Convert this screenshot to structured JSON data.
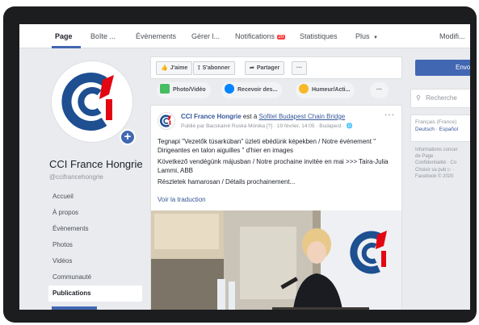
{
  "tabs": [
    {
      "label": "Page",
      "active": true
    },
    {
      "label": "Boîte ..."
    },
    {
      "label": "Évènements"
    },
    {
      "label": "Gérer l..."
    },
    {
      "label": "Notifications",
      "badge": "20"
    },
    {
      "label": "Statistiques"
    },
    {
      "label": "Plus"
    },
    {
      "label": "Modifi..."
    }
  ],
  "page": {
    "name": "CCI France Hongrie",
    "handle": "@ccifrancehongrie"
  },
  "side_nav": [
    "Accueil",
    "À propos",
    "Évènements",
    "Photos",
    "Vidéos",
    "Communauté",
    "Publications"
  ],
  "side_nav_active": "Publications",
  "actions": {
    "like": "J'aime",
    "follow": "S'abonner",
    "share": "Partager",
    "more": "···"
  },
  "composer": {
    "photo": "Photo/Vidéo",
    "messages": "Recevoir des...",
    "mood": "Humeur/Acti...",
    "more": "···"
  },
  "post": {
    "author": "CCI France Hongrie",
    "at_text": "est à",
    "location": "Sofitel Budapest Chain Bridge",
    "meta": "Publié par Bacskainé Ruska Mónika [?] · 19 février, 14:05 · Budapest · ",
    "text1": "Tegnapi \"Vezetők túsarkúban\" üzleti ebédünk képekben / Notre événement \" Dirigeantes en talon aiguilles \" d'hier en images",
    "text2": "Következő vendégünk májusban / Notre prochaine invitée en mai >>> Taira-Julia Lammi, ABB",
    "text3": "Részletek hamarosan / Détails prochainement...",
    "see_translation": "Voir la traduction",
    "dots": "···"
  },
  "right": {
    "send_label": "Envo",
    "search_placeholder": "Recherche",
    "lang_line1": "Français (France)",
    "lang_line2": "Deutsch · Español",
    "footer1": "Informations concer",
    "footer2": "de Page",
    "footer3": "Confidentialité · Co",
    "footer4": "Choisir sa pub ▷ ·",
    "footer5": "Facebook © 2020"
  },
  "colors": {
    "brand_blue": "#4267b2",
    "logo_blue": "#1d4f91",
    "logo_red": "#e30613"
  }
}
